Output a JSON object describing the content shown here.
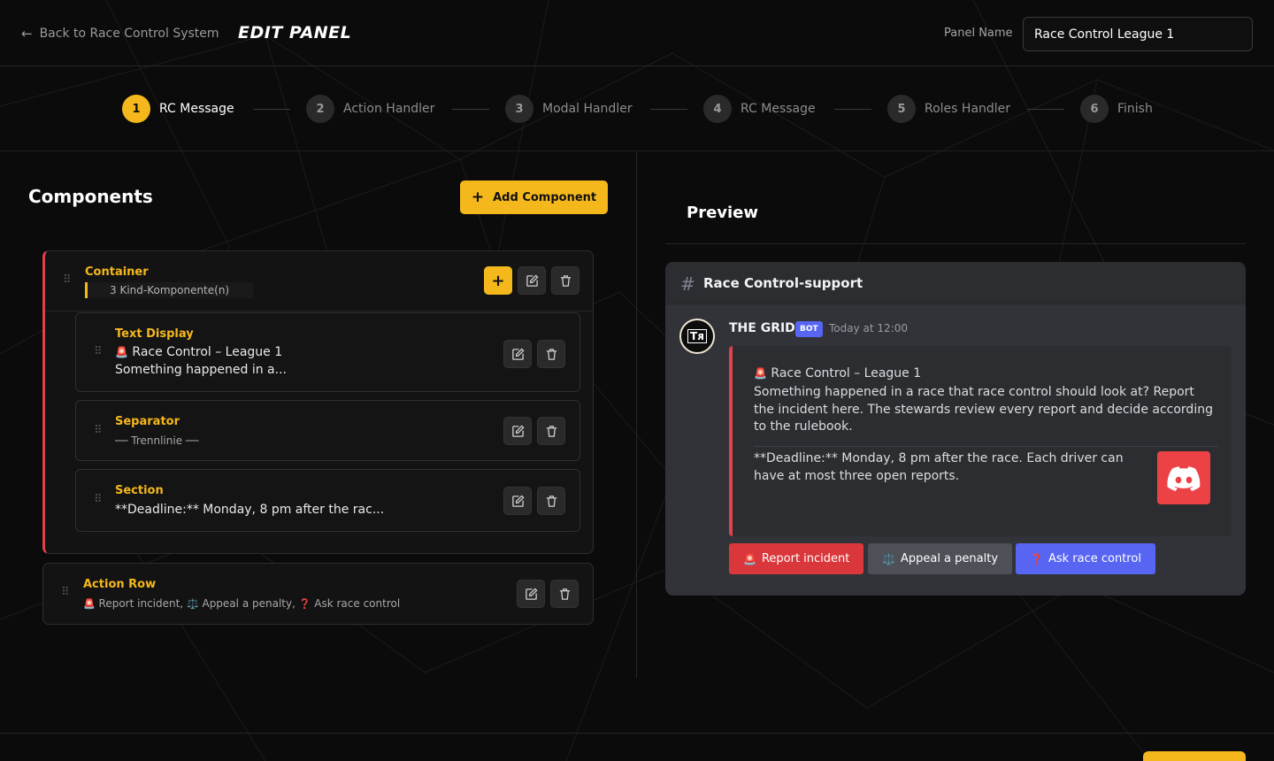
{
  "header": {
    "back_label": "Back to Race Control System",
    "title": "EDIT PANEL",
    "panel_name_label": "Panel Name",
    "panel_name_value": "Race Control League 1"
  },
  "stepper": {
    "steps": [
      {
        "num": "1",
        "label": "RC Message",
        "active": true
      },
      {
        "num": "2",
        "label": "Action Handler",
        "active": false
      },
      {
        "num": "3",
        "label": "Modal Handler",
        "active": false
      },
      {
        "num": "4",
        "label": "RC Message",
        "active": false
      },
      {
        "num": "5",
        "label": "Roles Handler",
        "active": false
      },
      {
        "num": "6",
        "label": "Finish",
        "active": false
      }
    ]
  },
  "components": {
    "title": "Components",
    "add_label": "Add Component",
    "container": {
      "type": "Container",
      "child_count": "3 Kind-Komponente(n)",
      "children": [
        {
          "type": "Text Display",
          "line1_emoji": "🚨",
          "line1": "Race Control – League 1",
          "line2": "Something happened in a..."
        },
        {
          "type": "Separator",
          "line1": "── Trennlinie ──"
        },
        {
          "type": "Section",
          "line1": "**Deadline:** Monday, 8 pm after the rac..."
        }
      ]
    },
    "action_row": {
      "type": "Action Row",
      "items": [
        {
          "emoji": "🚨",
          "label": "Report incident,"
        },
        {
          "emoji": "⚖️",
          "label": "Appeal a penalty,"
        },
        {
          "emoji": "❓",
          "label": "Ask race control"
        }
      ]
    }
  },
  "preview": {
    "title": "Preview",
    "channel": "Race Control-support",
    "author": "THE GRID",
    "bot_tag": "BOT",
    "timestamp": "Today at 12:00",
    "avatar_text": "Tᴙ",
    "embed": {
      "title_emoji": "🚨",
      "title": "Race Control – League 1",
      "body": "Something happened in a race that race control should look at? Report the incident here. The stewards review every report and decide according to the rulebook.",
      "deadline": "**Deadline:** Monday, 8 pm after the race. Each driver can have at most three open reports."
    },
    "buttons": [
      {
        "emoji": "🚨",
        "label": "Report incident",
        "style": "red"
      },
      {
        "emoji": "⚖️",
        "label": "Appeal a penalty",
        "style": "grey"
      },
      {
        "emoji": "❓",
        "label": "Ask race control",
        "style": "blurple"
      }
    ]
  },
  "colors": {
    "accent": "#f5b81c",
    "danger": "#e0424a",
    "discord_blurple": "#5865f2",
    "discord_bg": "#313338"
  }
}
